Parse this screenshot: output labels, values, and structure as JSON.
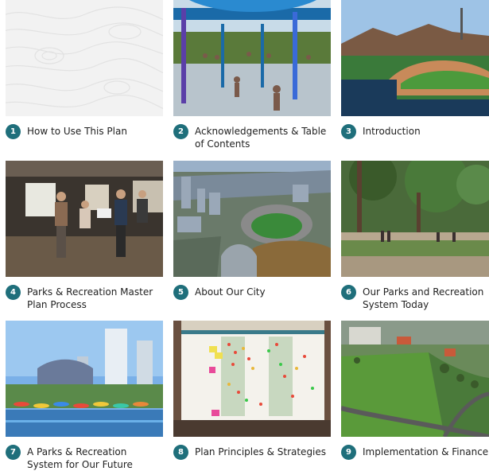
{
  "cards": [
    {
      "number": "1",
      "label": "How to Use This Plan"
    },
    {
      "number": "2",
      "label": "Acknowledgements & Table of Contents"
    },
    {
      "number": "3",
      "label": "Introduction"
    },
    {
      "number": "4",
      "label": "Parks & Recreation Master Plan Process"
    },
    {
      "number": "5",
      "label": "About Our City"
    },
    {
      "number": "6",
      "label": "Our Parks and Recreation System Today"
    },
    {
      "number": "7",
      "label": "A Parks & Recreation System for Our Future"
    },
    {
      "number": "8",
      "label": "Plan Principles & Strategies"
    },
    {
      "number": "9",
      "label": "Implementation & Finance"
    }
  ],
  "colors": {
    "badge": "#1f6f7b"
  }
}
